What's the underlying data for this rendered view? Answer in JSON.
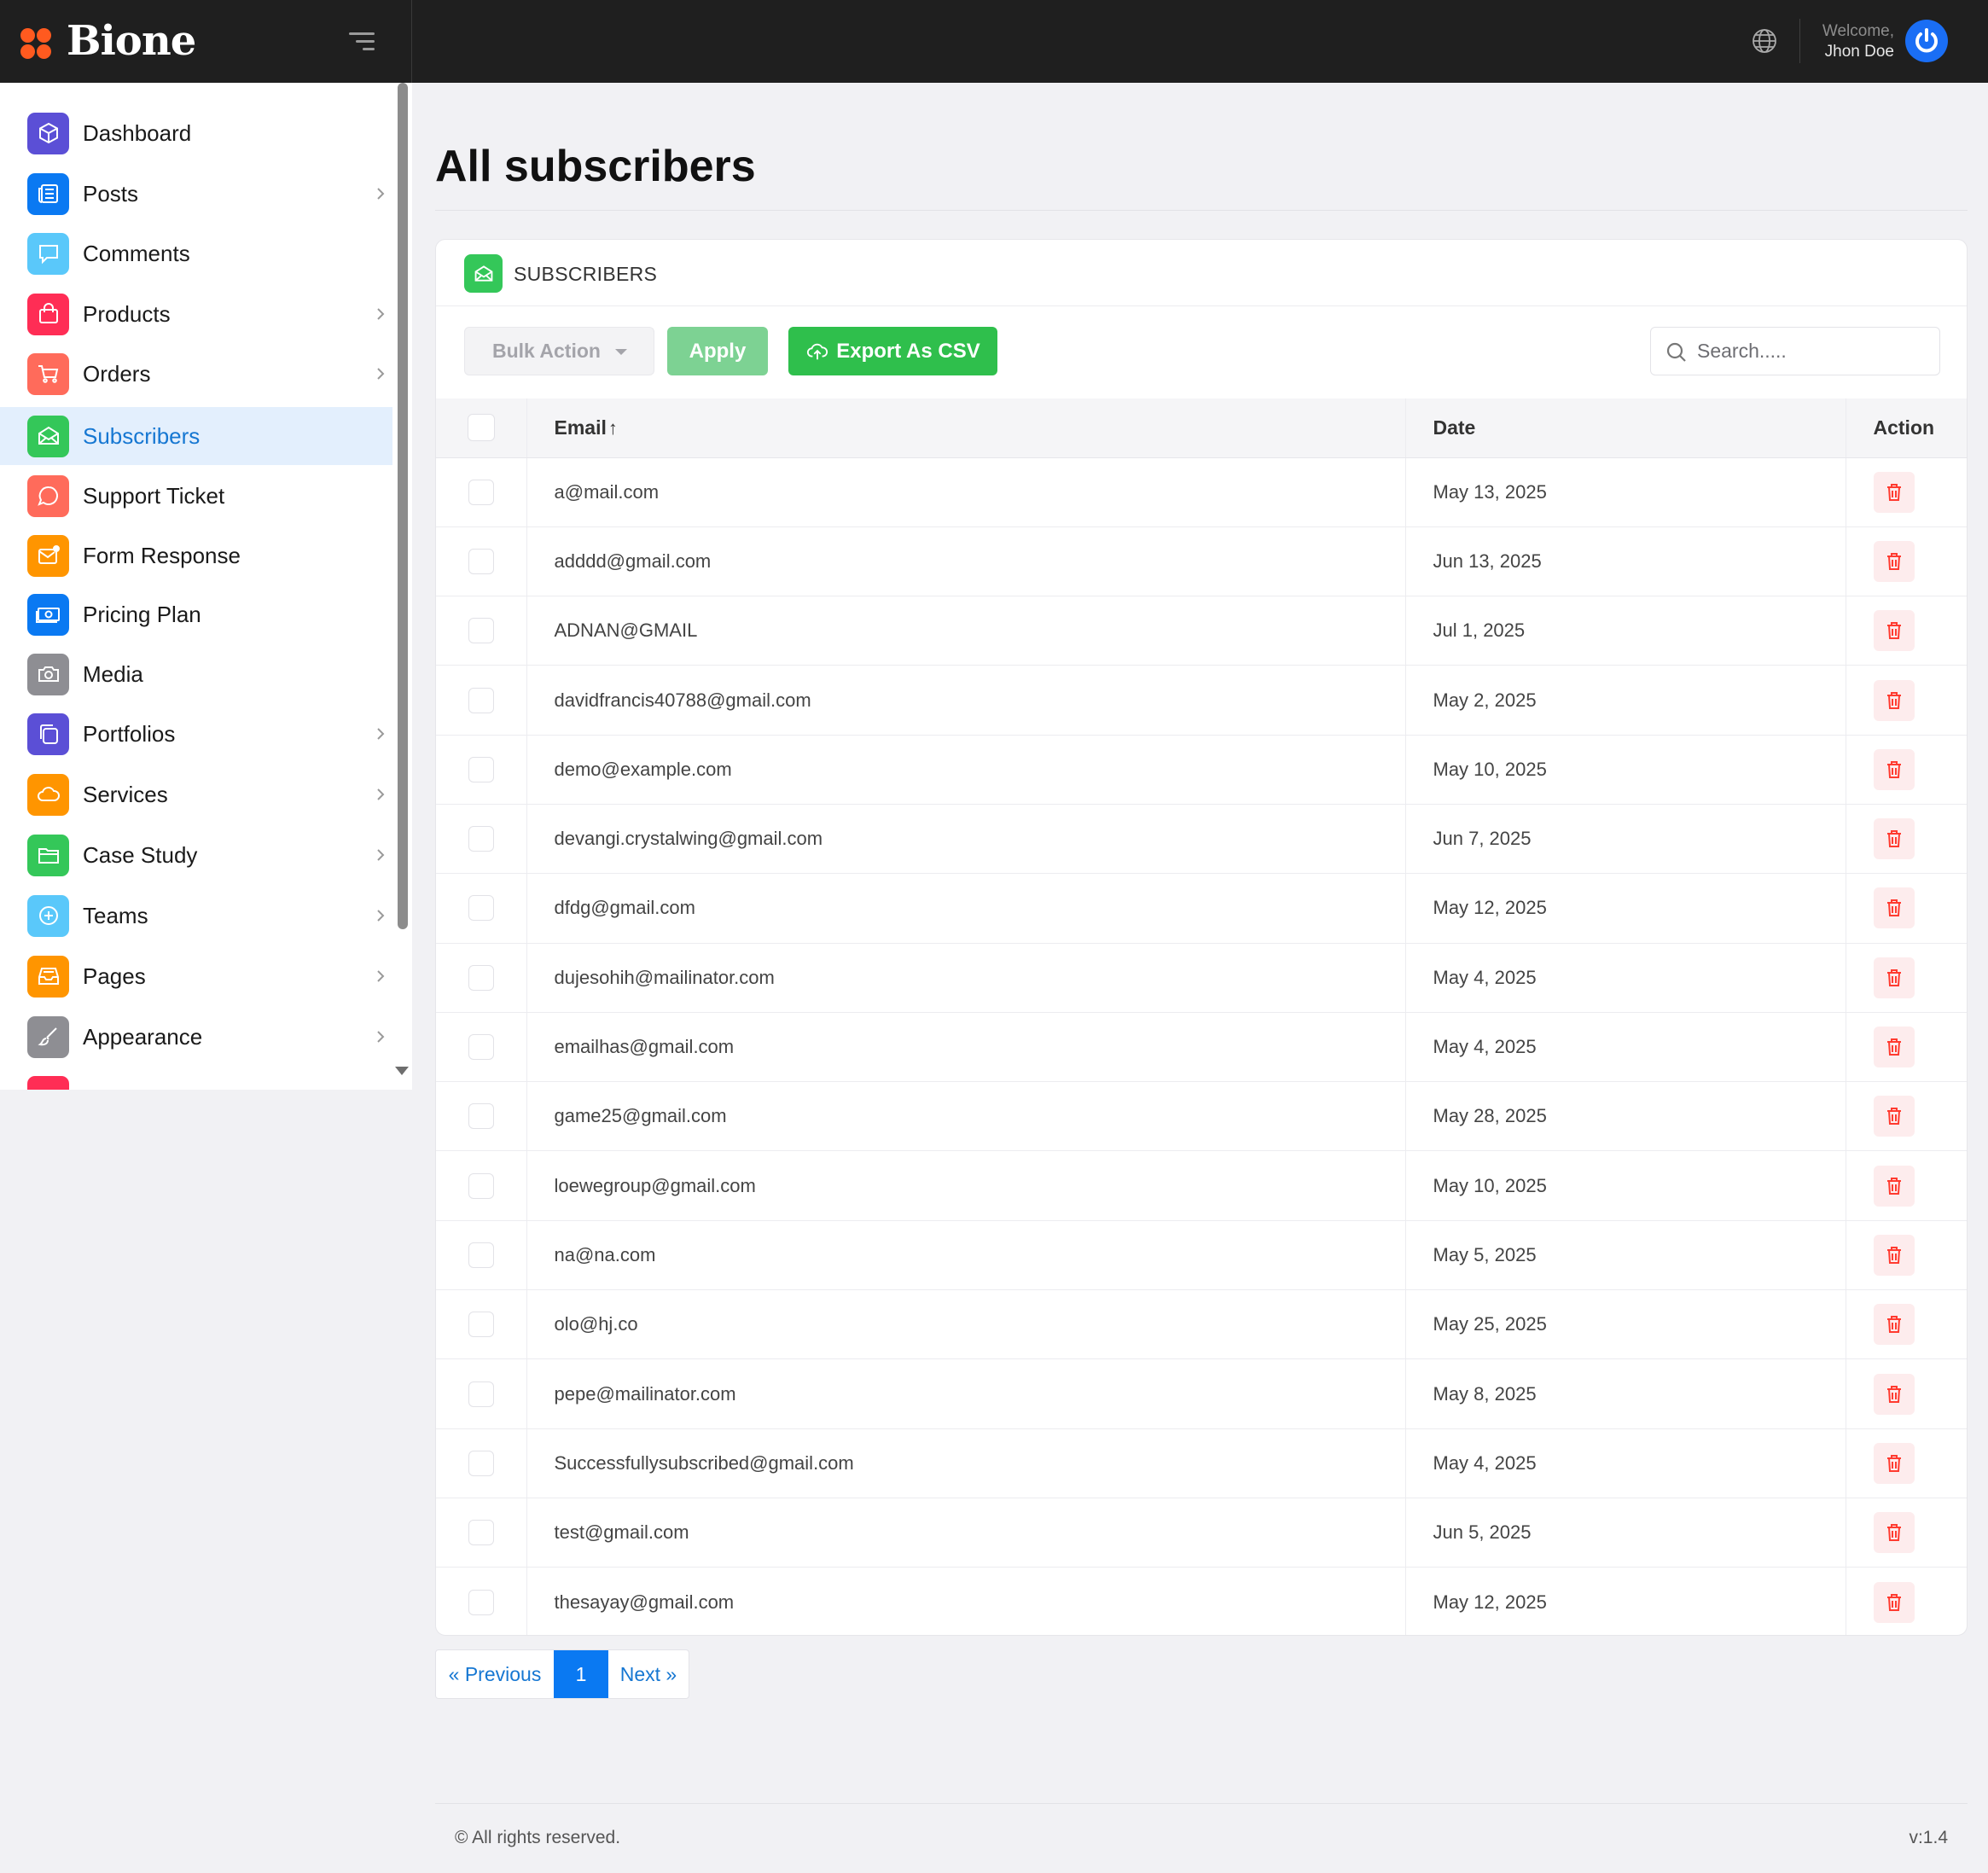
{
  "brand": {
    "name": "Bione"
  },
  "header": {
    "welcome_label": "Welcome,",
    "user_name": "Jhon Doe"
  },
  "sidebar": {
    "items": [
      {
        "label": "Dashboard",
        "icon": "cube-icon",
        "color": "#5b4fd6",
        "has_children": false,
        "active": false
      },
      {
        "label": "Posts",
        "icon": "newspaper-icon",
        "color": "#0a79f2",
        "has_children": true,
        "active": false
      },
      {
        "label": "Comments",
        "icon": "speech-bubble-icon",
        "color": "#5ac8fa",
        "has_children": false,
        "active": false
      },
      {
        "label": "Products",
        "icon": "shopping-bag-icon",
        "color": "#ff2d55",
        "has_children": true,
        "active": false
      },
      {
        "label": "Orders",
        "icon": "cart-icon",
        "color": "#ff6b5b",
        "has_children": true,
        "active": false
      },
      {
        "label": "Subscribers",
        "icon": "envelope-open-icon",
        "color": "#34c759",
        "has_children": false,
        "active": true
      },
      {
        "label": "Support Ticket",
        "icon": "chat-bubble-icon",
        "color": "#ff6b5b",
        "has_children": false,
        "active": false
      },
      {
        "label": "Form Response",
        "icon": "mail-notification-icon",
        "color": "#ff9500",
        "has_children": false,
        "active": false
      },
      {
        "label": "Pricing Plan",
        "icon": "cash-icon",
        "color": "#0a79f2",
        "has_children": false,
        "active": false
      },
      {
        "label": "Media",
        "icon": "camera-icon",
        "color": "#8e8e93",
        "has_children": false,
        "active": false
      },
      {
        "label": "Portfolios",
        "icon": "layers-icon",
        "color": "#5b4fd6",
        "has_children": true,
        "active": false
      },
      {
        "label": "Services",
        "icon": "cloud-icon",
        "color": "#ff9500",
        "has_children": true,
        "active": false
      },
      {
        "label": "Case Study",
        "icon": "folder-icon",
        "color": "#34c759",
        "has_children": true,
        "active": false
      },
      {
        "label": "Teams",
        "icon": "plus-circle-icon",
        "color": "#5ac8fa",
        "has_children": true,
        "active": false
      },
      {
        "label": "Pages",
        "icon": "inbox-icon",
        "color": "#ff9500",
        "has_children": true,
        "active": false
      },
      {
        "label": "Appearance",
        "icon": "brush-icon",
        "color": "#8e8e93",
        "has_children": true,
        "active": false
      }
    ]
  },
  "main": {
    "title": "All subscribers",
    "card_title": "SUBSCRIBERS",
    "bulk_action_label": "Bulk Action",
    "apply_label": "Apply",
    "export_label": "Export As CSV",
    "search_placeholder": "Search.....",
    "columns": {
      "email": "Email",
      "date": "Date",
      "action": "Action"
    },
    "rows": [
      {
        "email": "a@mail.com",
        "date": "May 13, 2025"
      },
      {
        "email": "adddd@gmail.com",
        "date": "Jun 13, 2025"
      },
      {
        "email": "ADNAN@GMAIL",
        "date": "Jul 1, 2025"
      },
      {
        "email": "davidfrancis40788@gmail.com",
        "date": "May 2, 2025"
      },
      {
        "email": "demo@example.com",
        "date": "May 10, 2025"
      },
      {
        "email": "devangi.crystalwing@gmail.com",
        "date": "Jun 7, 2025"
      },
      {
        "email": "dfdg@gmail.com",
        "date": "May 12, 2025"
      },
      {
        "email": "dujesohih@mailinator.com",
        "date": "May 4, 2025"
      },
      {
        "email": "emailhas@gmail.com",
        "date": "May 4, 2025"
      },
      {
        "email": "game25@gmail.com",
        "date": "May 28, 2025"
      },
      {
        "email": "loewegroup@gmail.com",
        "date": "May 10, 2025"
      },
      {
        "email": "na@na.com",
        "date": "May 5, 2025"
      },
      {
        "email": "olo@hj.co",
        "date": "May 25, 2025"
      },
      {
        "email": "pepe@mailinator.com",
        "date": "May 8, 2025"
      },
      {
        "email": "Successfullysubscribed@gmail.com",
        "date": "May 4, 2025"
      },
      {
        "email": "test@gmail.com",
        "date": "Jun 5, 2025"
      },
      {
        "email": "thesayay@gmail.com",
        "date": "May 12, 2025"
      }
    ]
  },
  "pagination": {
    "prev_label": "« Previous",
    "current_page": "1",
    "next_label": "Next »"
  },
  "footer": {
    "copyright": "© All rights reserved.",
    "version": "v:1.4"
  },
  "colors": {
    "accent": "#0a79f2",
    "header_bg": "#1f1f1f",
    "success": "#2fbf4c",
    "danger": "#ff3b30"
  }
}
